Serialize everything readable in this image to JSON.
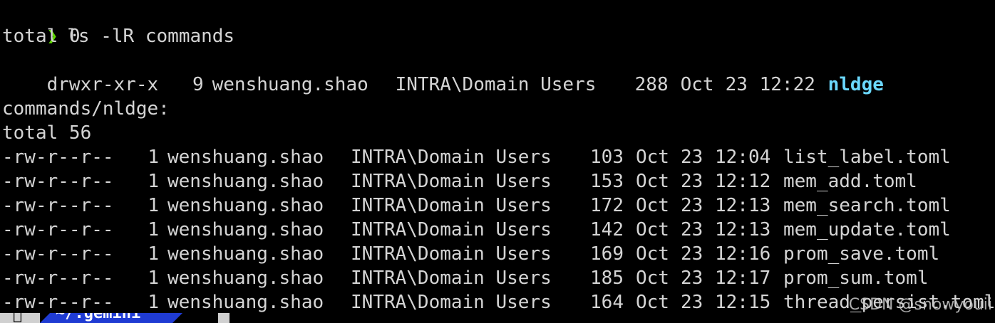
{
  "terminal": {
    "prompt_symbol": "❯",
    "command": "ls -lR commands",
    "top_total": "total 0",
    "dir_entry": {
      "perm": "drwxr-xr-x",
      "links": "9",
      "owner": "wenshuang.shao",
      "group": "INTRA\\Domain Users",
      "size": "288",
      "month": "Oct",
      "day": "23",
      "time": "12:22",
      "name": "nldge"
    },
    "subdir_header": "commands/nldge:",
    "sub_total": "total 56",
    "files": [
      {
        "perm": "-rw-r--r--",
        "links": "1",
        "owner": "wenshuang.shao",
        "group": "INTRA\\Domain Users",
        "size": "103",
        "month": "Oct",
        "day": "23",
        "time": "12:04",
        "name": "list_label.toml"
      },
      {
        "perm": "-rw-r--r--",
        "links": "1",
        "owner": "wenshuang.shao",
        "group": "INTRA\\Domain Users",
        "size": "153",
        "month": "Oct",
        "day": "23",
        "time": "12:12",
        "name": "mem_add.toml"
      },
      {
        "perm": "-rw-r--r--",
        "links": "1",
        "owner": "wenshuang.shao",
        "group": "INTRA\\Domain Users",
        "size": "172",
        "month": "Oct",
        "day": "23",
        "time": "12:13",
        "name": "mem_search.toml"
      },
      {
        "perm": "-rw-r--r--",
        "links": "1",
        "owner": "wenshuang.shao",
        "group": "INTRA\\Domain Users",
        "size": "142",
        "month": "Oct",
        "day": "23",
        "time": "12:13",
        "name": "mem_update.toml"
      },
      {
        "perm": "-rw-r--r--",
        "links": "1",
        "owner": "wenshuang.shao",
        "group": "INTRA\\Domain Users",
        "size": "169",
        "month": "Oct",
        "day": "23",
        "time": "12:16",
        "name": "prom_save.toml"
      },
      {
        "perm": "-rw-r--r--",
        "links": "1",
        "owner": "wenshuang.shao",
        "group": "INTRA\\Domain Users",
        "size": "185",
        "month": "Oct",
        "day": "23",
        "time": "12:17",
        "name": "prom_sum.toml"
      },
      {
        "perm": "-rw-r--r--",
        "links": "1",
        "owner": "wenshuang.shao",
        "group": "INTRA\\Domain Users",
        "size": "164",
        "month": "Oct",
        "day": "23",
        "time": "12:15",
        "name": "thread_persist.toml"
      }
    ]
  },
  "statusbar": {
    "os_icon": "apple-icon",
    "path": "~/.gemini"
  },
  "watermark": "CSDN @snowyouii",
  "colors": {
    "background": "#000000",
    "text": "#d4d4d4",
    "prompt": "#5fd700",
    "directory": "#6bd8ff",
    "path_segment": "#1f3bd3"
  }
}
